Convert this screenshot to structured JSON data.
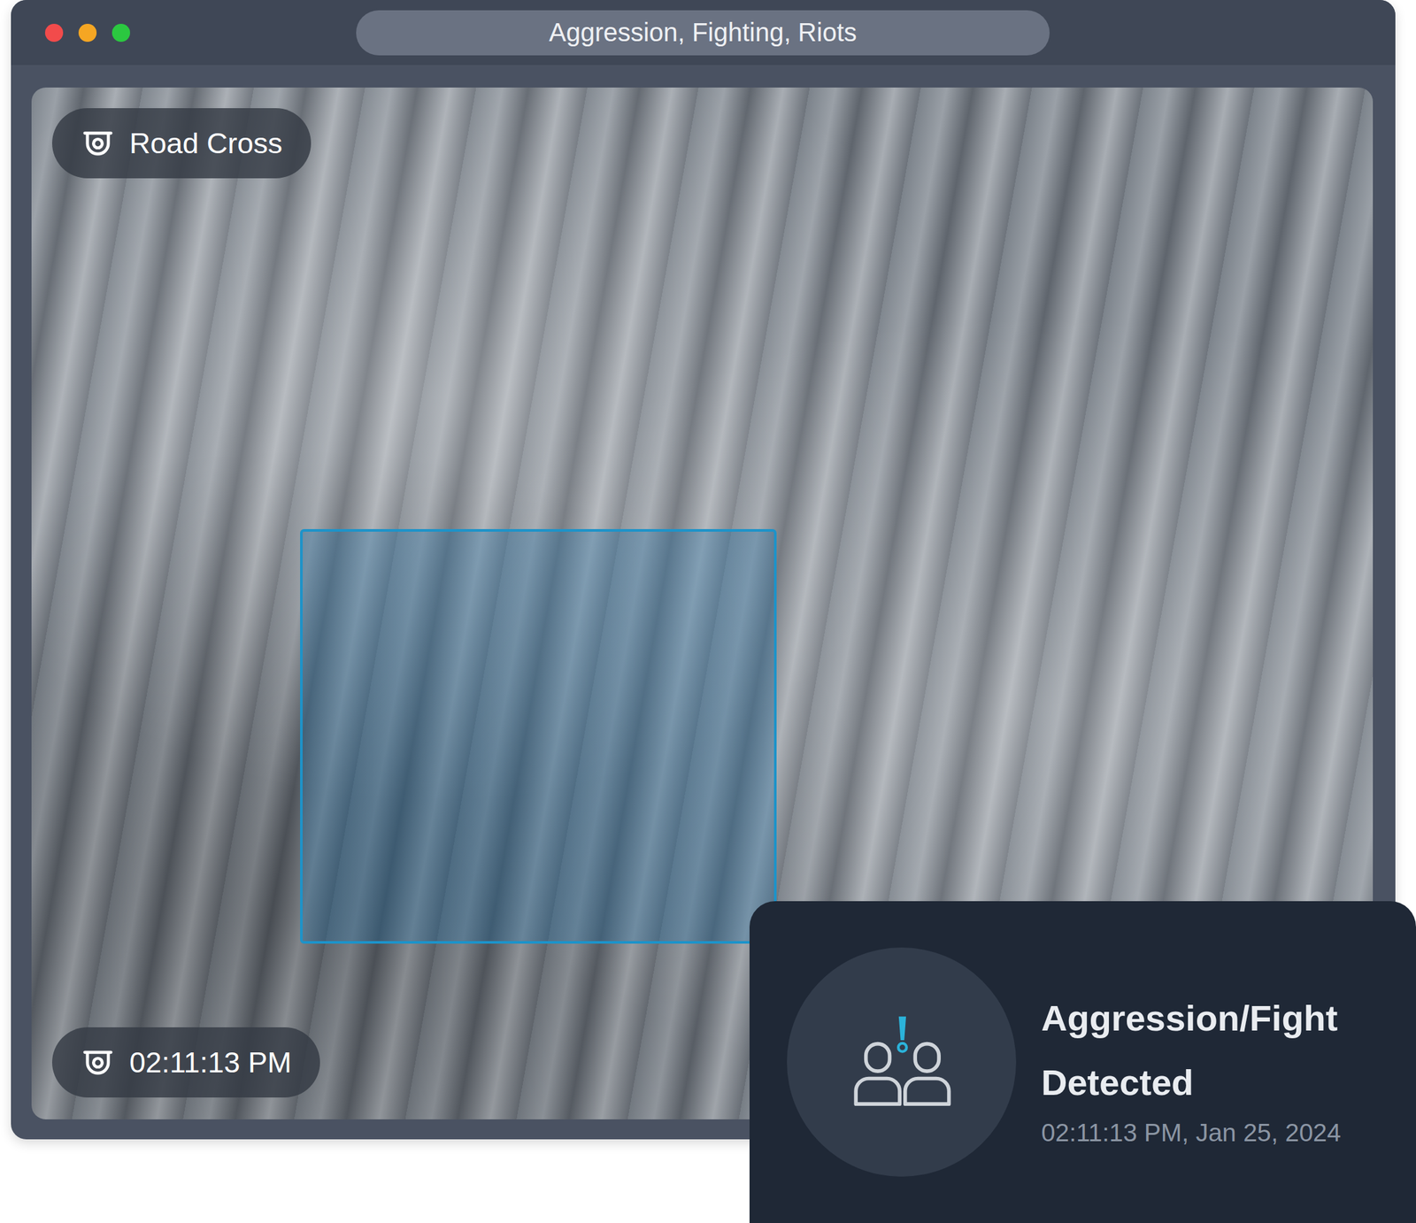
{
  "window": {
    "title": "Aggression, Fighting, Riots"
  },
  "camera": {
    "label": "Road Cross",
    "time": "02:11:13 PM"
  },
  "alert": {
    "title_lines": [
      "Aggression/Fight",
      "Detected"
    ],
    "timestamp": "02:11:13 PM, Jan 25, 2024"
  }
}
